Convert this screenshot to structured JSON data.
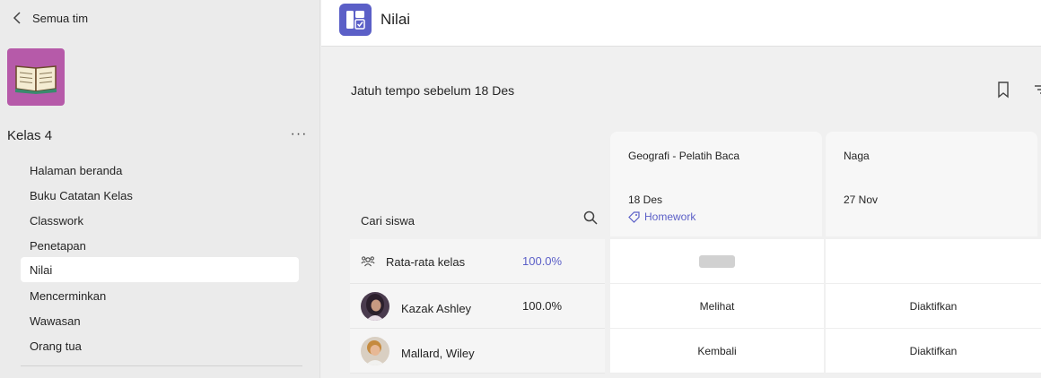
{
  "sidebar": {
    "back_label": "Semua tim",
    "team_name": "Kelas 4",
    "more_label": "···",
    "items": [
      {
        "label": "Halaman beranda",
        "active": false
      },
      {
        "label": "Buku Catatan Kelas",
        "active": false
      },
      {
        "label": "Classwork",
        "active": false
      },
      {
        "label": "Penetapan",
        "active": false
      },
      {
        "label": "Nilai",
        "active": true
      },
      {
        "label": "Mencerminkan",
        "active": false
      },
      {
        "label": "Wawasan",
        "active": false
      },
      {
        "label": "Orang tua",
        "active": false
      }
    ]
  },
  "header": {
    "title": "Nilai",
    "icon": "grades-app-icon"
  },
  "main": {
    "due_label": "Jatuh tempo sebelum 18 Des",
    "search_label": "Cari siswa",
    "assignments": [
      {
        "title": "Geografi - Pelatih Baca",
        "date": "18 Des",
        "tag": "Homework"
      },
      {
        "title": "Naga",
        "date": "27 Nov",
        "tag": ""
      }
    ],
    "class_average": {
      "label": "Rata-rata kelas",
      "value": "100.0%"
    },
    "students": [
      {
        "name": "Kazak Ashley",
        "grade": "100.0%",
        "cells": [
          "Melihat",
          "Diaktifkan"
        ]
      },
      {
        "name": "Mallard, Wiley",
        "grade": "",
        "cells": [
          "Kembali",
          "Diaktifkan"
        ]
      }
    ]
  },
  "colors": {
    "accent": "#5b5fc7",
    "team_tile": "#b65aa9",
    "sidebar_bg": "#ebebeb"
  }
}
